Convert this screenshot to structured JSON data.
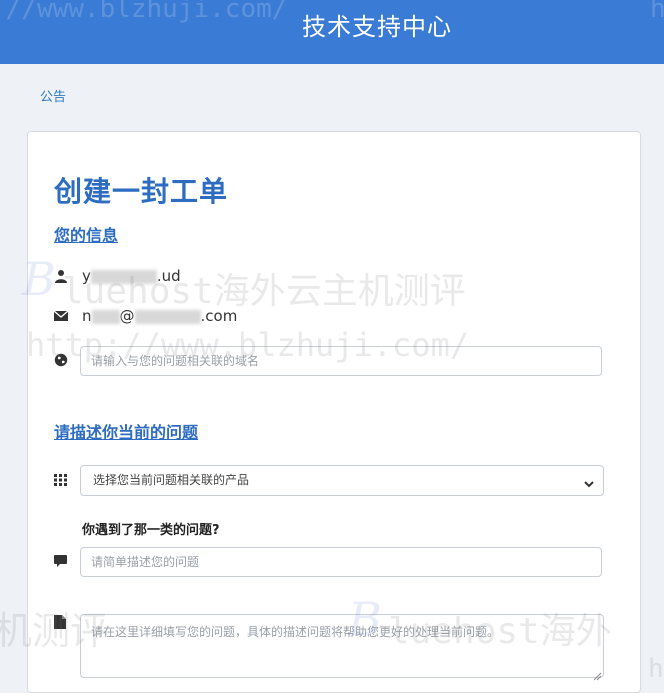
{
  "header": {
    "title": "技术支持中心"
  },
  "breadcrumb": {
    "label": "公告"
  },
  "form": {
    "heading": "创建一封工单",
    "info_section_label": "您的信息",
    "user": {
      "name_prefix": "y",
      "name_suffix": ".ud",
      "email_prefix": "n",
      "email_mid": "@",
      "email_suffix": ".com"
    },
    "domain_input": {
      "placeholder": "请输入与您的问题相关联的域名",
      "value": ""
    },
    "problem_section_label": "请描述你当前的问题",
    "product_select": {
      "selected": "选择您当前问题相关联的产品"
    },
    "question_label": "你遇到了那一类的问题?",
    "summary_input": {
      "placeholder": "请简单描述您的问题",
      "value": ""
    },
    "detail_textarea": {
      "placeholder": "请在这里详细填写您的问题，具体的描述问题将帮助您更好的处理当前问题。"
    }
  },
  "watermarks": {
    "top_url": "://www.blzhuji.com/",
    "brand_text": "luehost海外云主机测评",
    "mid_url": "http://www.blzhuji.com/",
    "bottom_left": "机测评",
    "bottom_right": "luehost海外",
    "top_right_edge": "h",
    "bottom_right_edge": "h"
  },
  "colors": {
    "header_bg": "#3a7bd5",
    "accent": "#2d6cc0",
    "page_bg": "#eef1f6"
  }
}
